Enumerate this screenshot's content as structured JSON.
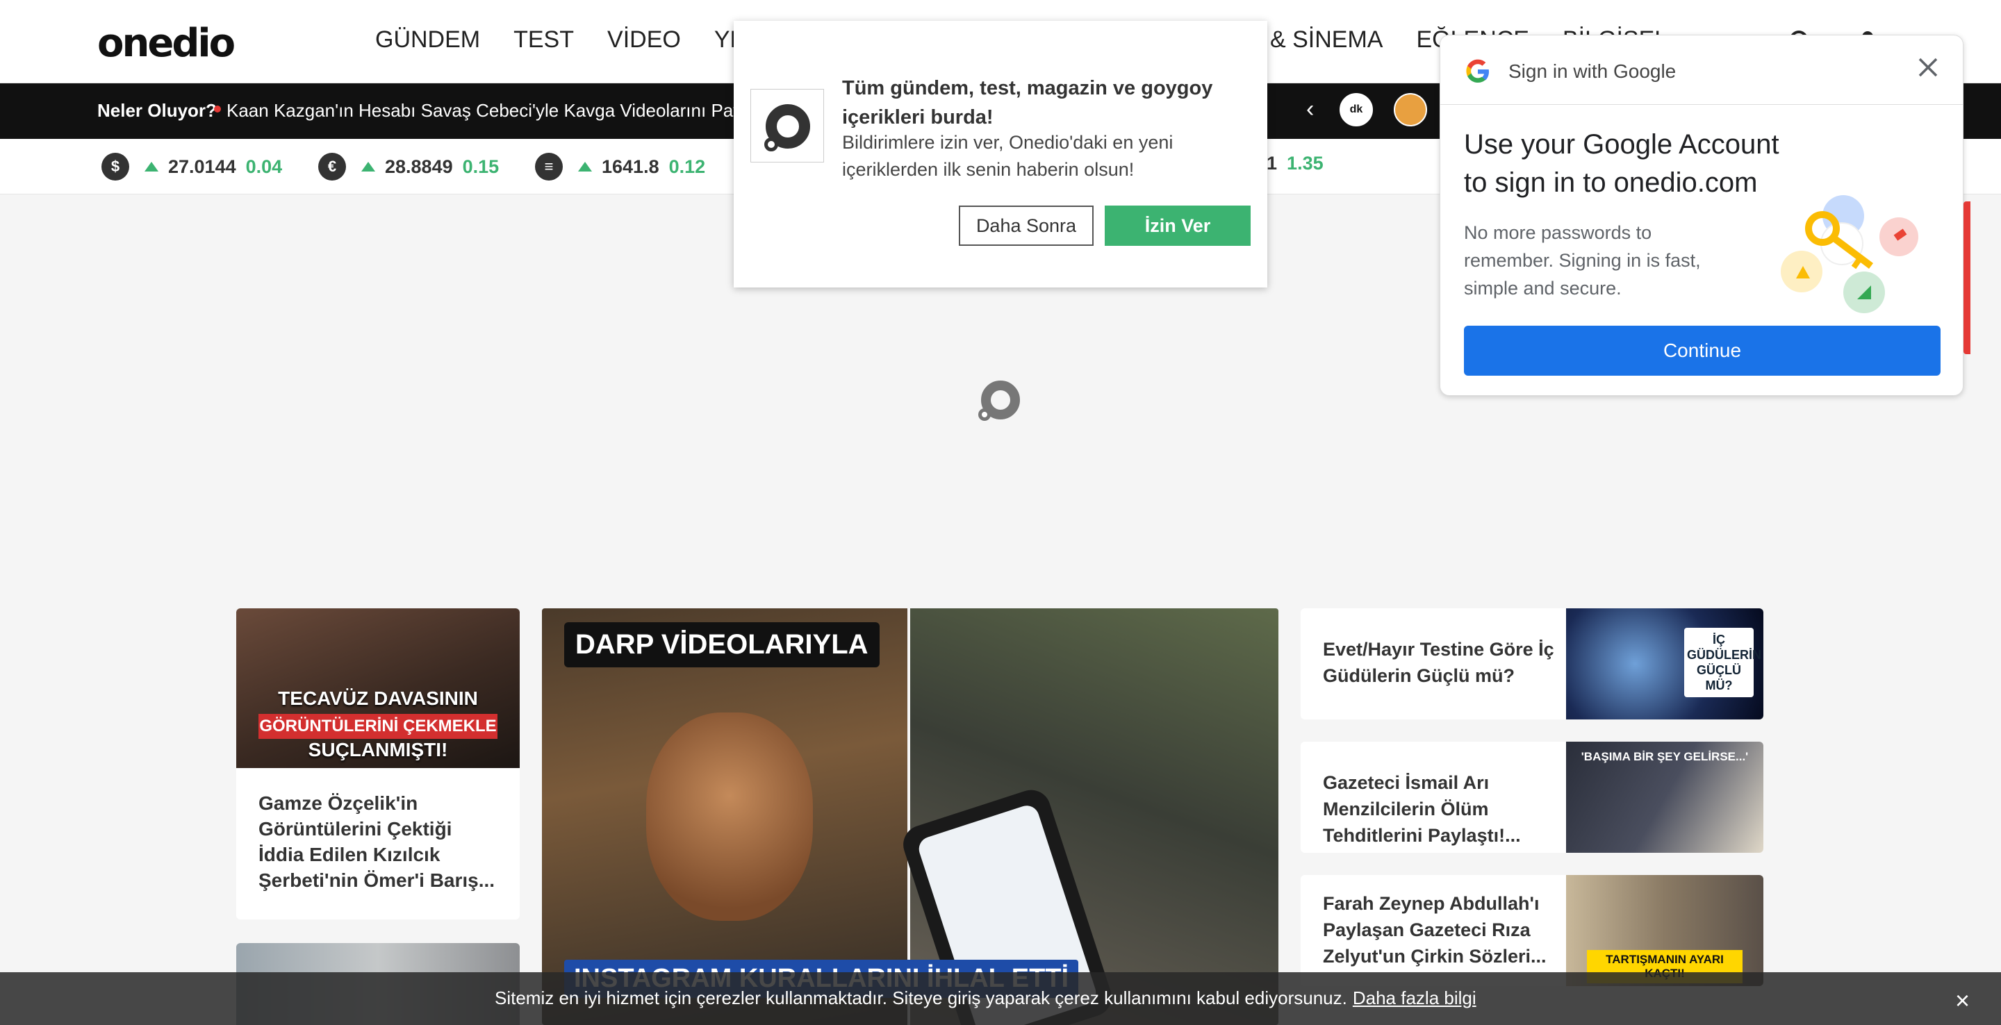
{
  "header": {
    "logo": "onedio",
    "nav": [
      "GÜNDEM",
      "TEST",
      "VİDEO",
      "YE"
    ],
    "nav_right": [
      "& SİNEMA",
      "EĞLENCE",
      "BİLGİSEL"
    ],
    "search_icon": "search-icon",
    "user_icon": "user-icon"
  },
  "ticker": {
    "label": "Neler Oluyor?",
    "headline": "Kaan Kazgan'ın Hesabı Savaş Cebeci'yle Kavga Videolarını Paylaş",
    "prev_label": "‹",
    "avatar_text": "dk"
  },
  "currency": [
    {
      "symbol": "$",
      "value": "27.0144",
      "change": "0.04"
    },
    {
      "symbol": "€",
      "value": "28.8849",
      "change": "0.15"
    },
    {
      "symbol": "≡",
      "value": "1641.8",
      "change": "0.12"
    },
    {
      "symbol": "",
      "value": "01",
      "change": "1.35"
    }
  ],
  "notification": {
    "title": "Tüm gündem, test, magazin ve goygoy içerikleri burda!",
    "body": "Bildirimlere izin ver, Onedio'daki en yeni içeriklerden ilk senin haberin olsun!",
    "later": "Daha Sonra",
    "allow": "İzin Ver"
  },
  "google": {
    "header": "Sign in with Google",
    "headline": "Use your Google Account to sign in to onedio.com",
    "body": "No more passwords to remember. Signing in is fast, simple and secure.",
    "continue": "Continue"
  },
  "cards": {
    "left": {
      "overlay1": "TECAVÜZ DAVASININ",
      "overlay2": "GÖRÜNTÜLERİNİ ÇEKMEKLE",
      "overlay3": "SUÇLANMIŞTI!",
      "title": "Gamze Özçelik'in Görüntülerini Çektiği İddia Edilen Kızılcık Şerbeti'nin Ömer'i Barış..."
    },
    "main": {
      "top_label": "DARP VİDEOLARIYLA",
      "bottom_label": "INSTAGRAM KURALLARINI İHLAL ETTİ"
    },
    "side": [
      {
        "title": "Evet/Hayır Testine Göre İç Güdülerin Güçlü mü?",
        "tag": "İÇ GÜDÜLERİN GÜÇLÜ MÜ?"
      },
      {
        "title": "Gazeteci İsmail Arı Menzilcilerin Ölüm Tehditlerini Paylaştı!...",
        "tag": "'BAŞIMA BİR ŞEY GELİRSE...'"
      },
      {
        "title": "Farah Zeynep Abdullah'ı Paylaşan Gazeteci Rıza Zelyut'un Çirkin Sözleri...",
        "tag": "TARTIŞMANIN AYARI KAÇTI!"
      }
    ]
  },
  "cookie": {
    "message": "Sitemiz en iyi hizmet için çerezler kullanmaktadır. Siteye giriş yaparak çerez kullanımını kabul ediyorsunuz.",
    "more": "Daha fazla bilgi",
    "close": "×"
  }
}
